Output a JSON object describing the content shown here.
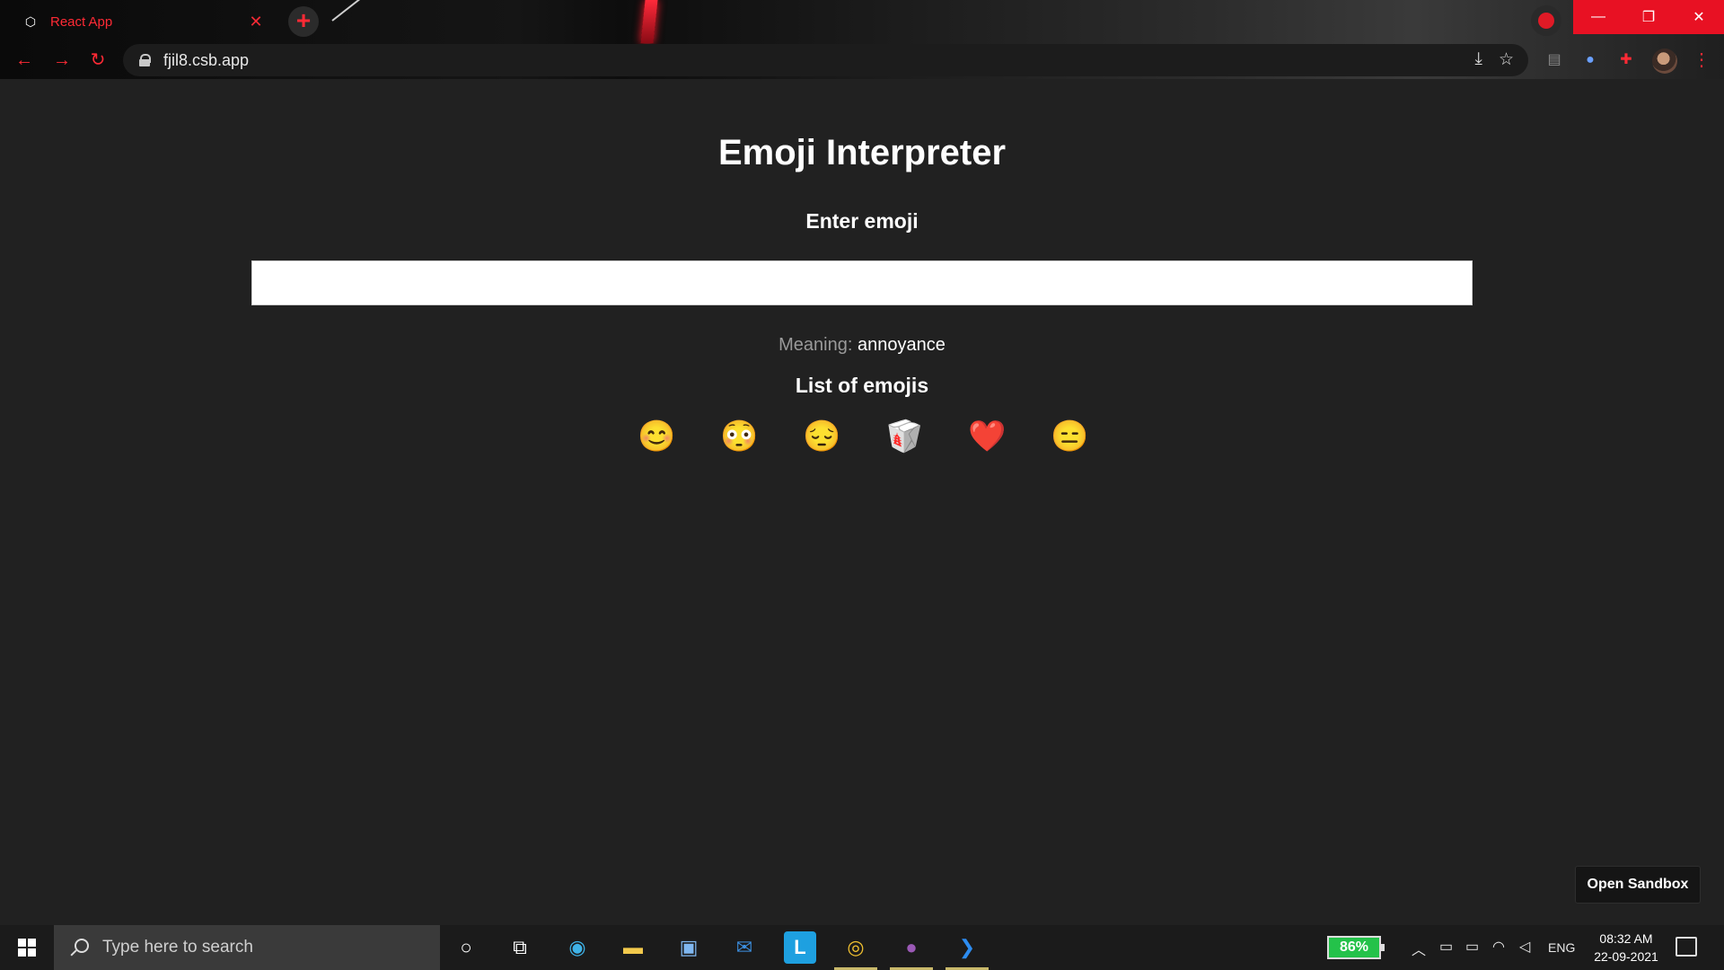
{
  "browser": {
    "tab_title": "React App",
    "url": "fjil8.csb.app"
  },
  "app": {
    "title": "Emoji Interpreter",
    "input_label": "Enter emoji",
    "input_value": "",
    "meaning_label": "Meaning:",
    "meaning_value": "annoyance",
    "list_label": "List of emojis",
    "emojis": [
      "😊",
      "😳",
      "😔",
      "🥡",
      "❤️",
      "😑"
    ],
    "open_sandbox": "Open Sandbox"
  },
  "taskbar": {
    "search_placeholder": "Type here to search",
    "battery": "86%",
    "language": "ENG",
    "time": "08:32 AM",
    "date": "22-09-2021"
  },
  "colors": {
    "accent": "#ff2a35",
    "page_bg": "#212121",
    "window_control_red": "#e81123",
    "battery_green": "#24c24a"
  }
}
